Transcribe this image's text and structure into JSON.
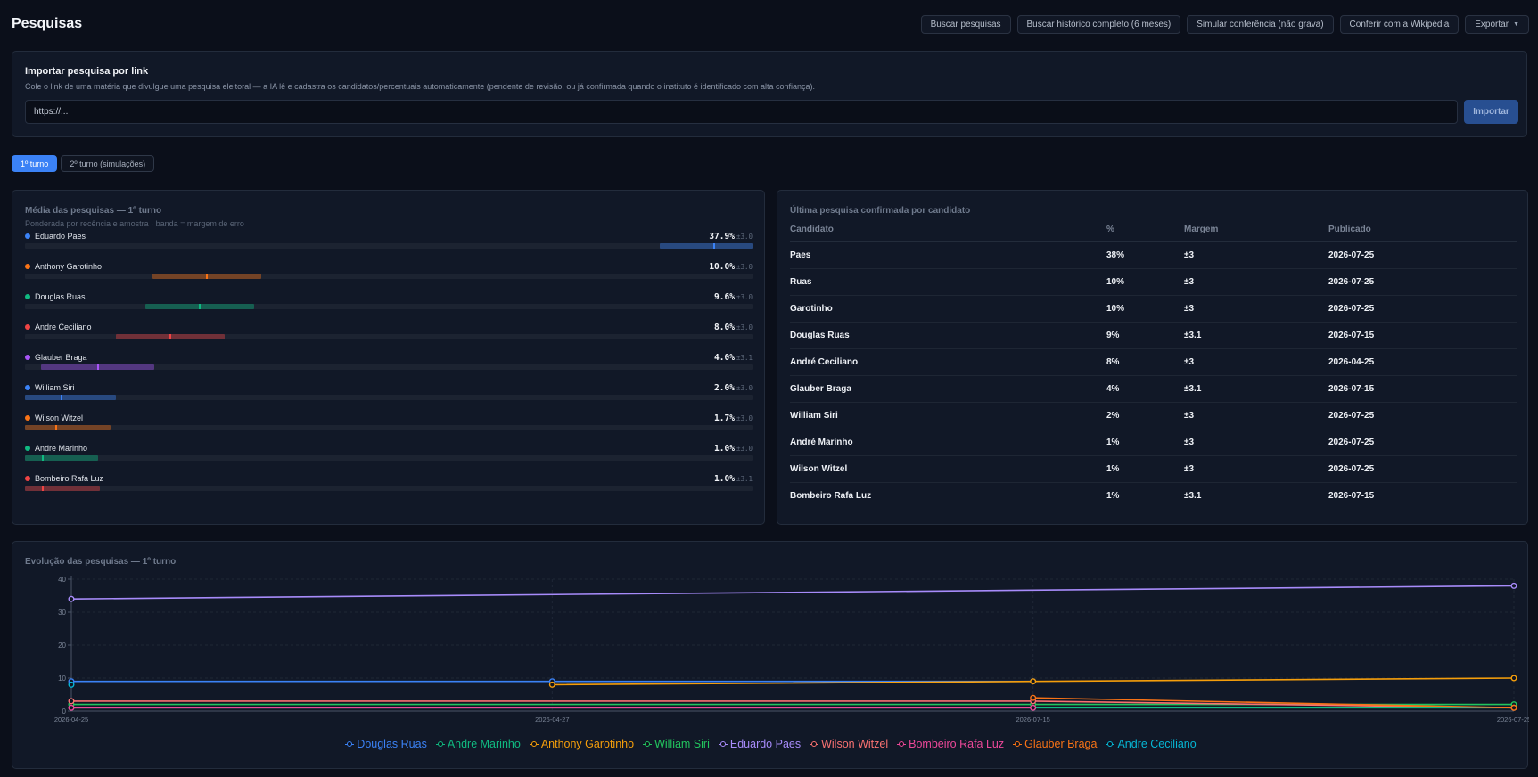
{
  "header": {
    "title": "Pesquisas",
    "actions": [
      "Buscar pesquisas",
      "Buscar histórico completo (6 meses)",
      "Simular conferência (não grava)",
      "Conferir com a Wikipédia",
      "Exportar"
    ],
    "export_caret_icon": "caret-down-icon"
  },
  "import": {
    "title": "Importar pesquisa por link",
    "description": "Cole o link de uma matéria que divulgue uma pesquisa eleitoral — a IA lê e cadastra os candidatos/percentuais automaticamente (pendente de revisão, ou já confirmada quando o instituto é identificado com alta confiança).",
    "placeholder": "https://...",
    "button": "Importar"
  },
  "tabs": [
    "1º turno",
    "2º turno (simulações)"
  ],
  "average": {
    "title": "Média das pesquisas — 1º turno",
    "subtitle": "Ponderada por recência e amostra · banda = margem de erro",
    "candidates": [
      {
        "name": "Eduardo Paes",
        "value": "37.9%",
        "margin": "±3.0",
        "pct": 37.9,
        "moe": 3.0,
        "color": "#3b82f6"
      },
      {
        "name": "Anthony Garotinho",
        "value": "10.0%",
        "margin": "±3.0",
        "pct": 10.0,
        "moe": 3.0,
        "color": "#f97316"
      },
      {
        "name": "Douglas Ruas",
        "value": "9.6%",
        "margin": "±3.0",
        "pct": 9.6,
        "moe": 3.0,
        "color": "#10b981"
      },
      {
        "name": "Andre Ceciliano",
        "value": "8.0%",
        "margin": "±3.0",
        "pct": 8.0,
        "moe": 3.0,
        "color": "#ef4444"
      },
      {
        "name": "Glauber Braga",
        "value": "4.0%",
        "margin": "±3.1",
        "pct": 4.0,
        "moe": 3.1,
        "color": "#a855f7"
      },
      {
        "name": "William Siri",
        "value": "2.0%",
        "margin": "±3.0",
        "pct": 2.0,
        "moe": 3.0,
        "color": "#3b82f6"
      },
      {
        "name": "Wilson Witzel",
        "value": "1.7%",
        "margin": "±3.0",
        "pct": 1.7,
        "moe": 3.0,
        "color": "#f97316"
      },
      {
        "name": "Andre Marinho",
        "value": "1.0%",
        "margin": "±3.0",
        "pct": 1.0,
        "moe": 3.0,
        "color": "#10b981"
      },
      {
        "name": "Bombeiro Rafa Luz",
        "value": "1.0%",
        "margin": "±3.1",
        "pct": 1.0,
        "moe": 3.1,
        "color": "#ef4444"
      }
    ]
  },
  "last_poll": {
    "title": "Última pesquisa confirmada por candidato",
    "columns": [
      "Candidato",
      "%",
      "Margem",
      "Publicado"
    ],
    "rows": [
      [
        "Paes",
        "38%",
        "±3",
        "2026-07-25"
      ],
      [
        "Ruas",
        "10%",
        "±3",
        "2026-07-25"
      ],
      [
        "Garotinho",
        "10%",
        "±3",
        "2026-07-25"
      ],
      [
        "Douglas Ruas",
        "9%",
        "±3.1",
        "2026-07-15"
      ],
      [
        "André Ceciliano",
        "8%",
        "±3",
        "2026-04-25"
      ],
      [
        "Glauber Braga",
        "4%",
        "±3.1",
        "2026-07-15"
      ],
      [
        "William Siri",
        "2%",
        "±3",
        "2026-07-25"
      ],
      [
        "André Marinho",
        "1%",
        "±3",
        "2026-07-25"
      ],
      [
        "Wilson Witzel",
        "1%",
        "±3",
        "2026-07-25"
      ],
      [
        "Bombeiro Rafa Luz",
        "1%",
        "±3.1",
        "2026-07-15"
      ]
    ]
  },
  "chart_data": {
    "type": "line",
    "title": "Evolução das pesquisas — 1º turno",
    "x": [
      "2026-04-25",
      "2026-04-27",
      "2026-07-15",
      "2026-07-25"
    ],
    "ylim": [
      0,
      40
    ],
    "yticks": [
      0,
      10,
      20,
      30,
      40
    ],
    "grid": true,
    "legend": "bottom",
    "series": [
      {
        "name": "Douglas Ruas",
        "color": "#3b82f6",
        "values": [
          9,
          9,
          9,
          null
        ]
      },
      {
        "name": "Andre Marinho",
        "color": "#10b981",
        "values": [
          1,
          null,
          1,
          1
        ]
      },
      {
        "name": "Anthony Garotinho",
        "color": "#f59e0b",
        "values": [
          null,
          8,
          9,
          10
        ]
      },
      {
        "name": "William Siri",
        "color": "#22c55e",
        "values": [
          2,
          null,
          2,
          2
        ]
      },
      {
        "name": "Eduardo Paes",
        "color": "#a78bfa",
        "values": [
          34,
          null,
          null,
          38
        ]
      },
      {
        "name": "Wilson Witzel",
        "color": "#f87171",
        "values": [
          3,
          null,
          3,
          1
        ]
      },
      {
        "name": "Bombeiro Rafa Luz",
        "color": "#ec4899",
        "values": [
          1,
          null,
          1,
          null
        ]
      },
      {
        "name": "Glauber Braga",
        "color": "#f97316",
        "values": [
          null,
          null,
          4,
          1
        ]
      },
      {
        "name": "Andre Ceciliano",
        "color": "#06b6d4",
        "values": [
          8,
          null,
          null,
          null
        ]
      }
    ]
  }
}
